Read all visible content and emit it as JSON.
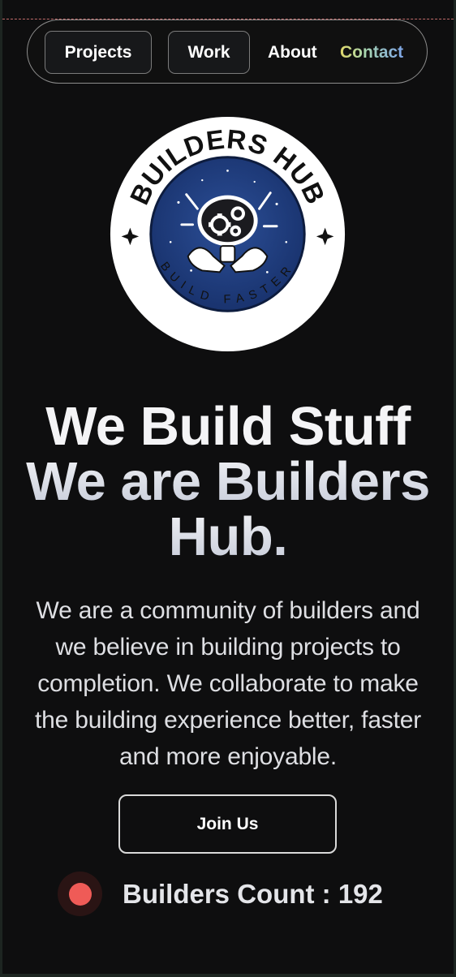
{
  "nav": {
    "projects_label": "Projects",
    "work_label": "Work",
    "about_label": "About",
    "contact_label": "Contact"
  },
  "logo": {
    "top_text": "BUILDERS HUB",
    "bottom_text": "BUILD FASTER",
    "icon": "brain-gears-hands-icon",
    "colors": {
      "ring": "#ffffff",
      "inner": "#1f3a7a",
      "text": "#111111"
    }
  },
  "hero": {
    "headline_line1": "We Build Stuff",
    "headline_line2": "We are Builders",
    "headline_line3": "Hub.",
    "description": "We are a community of builders and we believe in building projects to completion. We collaborate to make the building experience better, faster and more enjoyable.",
    "join_label": "Join Us",
    "count_label": "Builders Count : ",
    "count_value": "192"
  },
  "colors": {
    "background": "#0e0e0f",
    "status_dot": "#ef5b57",
    "contact_gradient": [
      "#e0d76a",
      "#a8d6b0",
      "#7fa6e8"
    ]
  }
}
